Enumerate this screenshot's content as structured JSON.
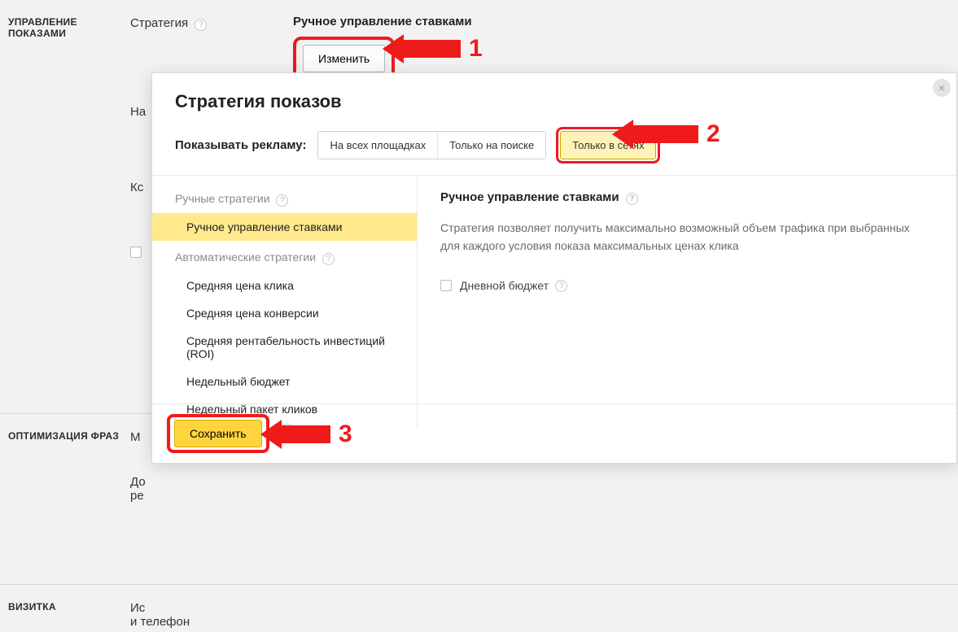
{
  "page": {
    "sections": {
      "display_control": {
        "title": "УПРАВЛЕНИЕ ПОКАЗАМИ",
        "strategy_label": "Стратегия",
        "strategy_value_title": "Ручное управление ставками",
        "change_button": "Изменить",
        "sub_row_1": "На",
        "sub_row_2": "Кс"
      },
      "phrase_opt": {
        "title": "ОПТИМИЗАЦИЯ ФРАЗ",
        "label_short": "М",
        "sub1": "До",
        "sub2": "ре"
      },
      "vcard": {
        "title": "ВИЗИТКА",
        "label1": "Ис",
        "label2": "и телефон"
      }
    }
  },
  "modal": {
    "title": "Стратегия показов",
    "show_ads_label": "Показывать рекламу:",
    "segments": {
      "all": "На всех площадках",
      "search": "Только на поиске",
      "networks": "Только в сетях"
    },
    "left": {
      "manual_group": "Ручные стратегии",
      "manual_item": "Ручное управление ставками",
      "auto_group": "Автоматические стратегии",
      "auto_items": [
        "Средняя цена клика",
        "Средняя цена конверсии",
        "Средняя рентабельность инвестиций (ROI)",
        "Недельный бюджет",
        "Недельный пакет кликов"
      ]
    },
    "right": {
      "title": "Ручное управление ставками",
      "desc": "Стратегия позволяет получить максимально возможный объем трафика при выбранных для каждого условия показа максимальных ценах клика",
      "daily_budget": "Дневной бюджет"
    },
    "footer": {
      "save": "Сохранить"
    },
    "close": "×"
  },
  "annotations": {
    "a1": "1",
    "a2": "2",
    "a3": "3"
  }
}
